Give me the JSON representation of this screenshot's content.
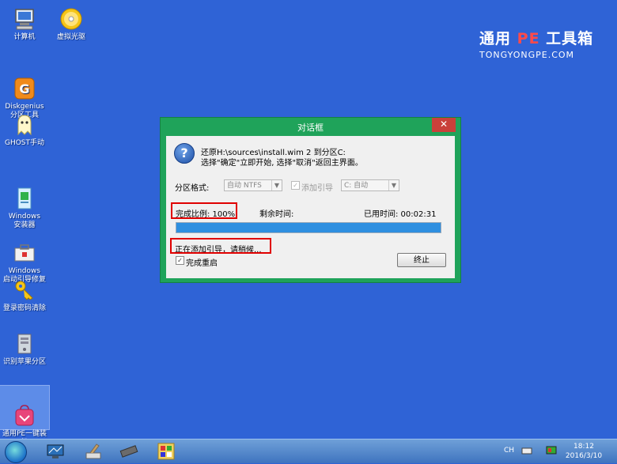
{
  "desktop": {
    "icons": [
      {
        "label": "计算机"
      },
      {
        "label": "虚拟光驱"
      },
      {
        "label": "Diskgenius\n分区工具"
      },
      {
        "label": "GHOST手动"
      },
      {
        "label": "Windows\n安装器"
      },
      {
        "label": "Windows\n启动引导修复"
      },
      {
        "label": "登录密码清除"
      },
      {
        "label": "识别苹果分区"
      },
      {
        "label": "通用PE一键装\n机"
      }
    ]
  },
  "brand": {
    "title_a": "通用",
    "title_pe": "PE",
    "title_b": "工具箱",
    "subtitle": "TONGYONGPE.COM"
  },
  "dialog": {
    "title": "对话框",
    "close_glyph": "✕",
    "message_line1": "还原H:\\sources\\install.wim 2 到分区C:",
    "message_line2": "选择\"确定\"立即开始, 选择\"取消\"返回主界面。",
    "format_label": "分区格式:",
    "format_value": "自动 NTFS",
    "add_boot_label": "添加引导",
    "boot_target_value": "C: 自动",
    "completion_label": "完成比例: 100%",
    "remaining_label": "剩余时间:",
    "elapsed_label": "已用时间: 00:02:31",
    "progress_percent": 100,
    "status_text": "正在添加引导，请稍候...",
    "reboot_label": "完成重启",
    "reboot_checked": "✓",
    "abort_button": "终止"
  },
  "taskbar": {
    "lang": "CH",
    "time": "18:12",
    "date": "2016/3/10"
  },
  "colors": {
    "desktop": "#2f63d6",
    "dialog_frame": "#1fa35a",
    "highlight": "#e00000",
    "progress": "#2e8fe0"
  }
}
